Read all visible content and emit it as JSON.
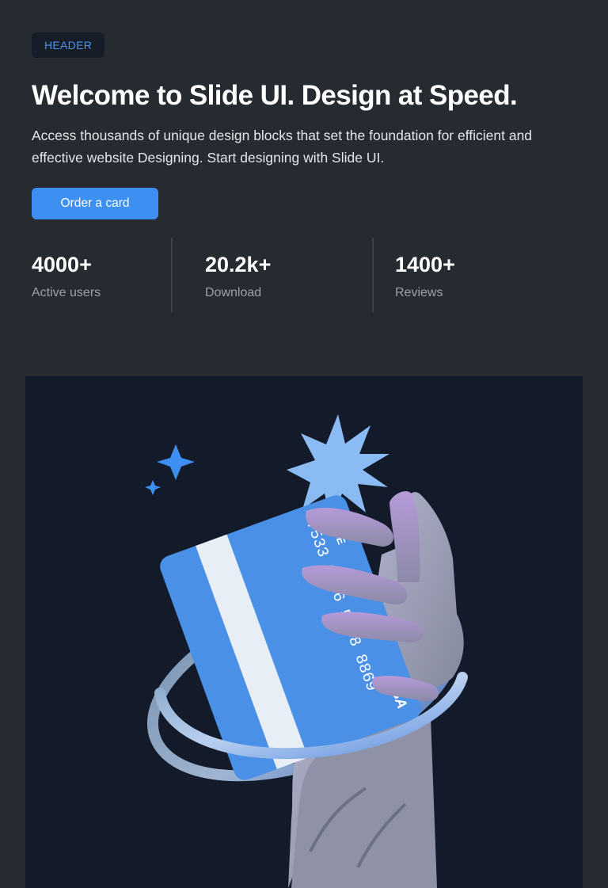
{
  "header": {
    "badge": "HEADER",
    "title": "Welcome to Slide UI. Design at Speed.",
    "description": "Access thousands of unique design blocks that set the foundation for efficient and effective website Designing. Start designing with Slide UI.",
    "cta_label": "Order a card"
  },
  "stats": [
    {
      "value": "4000+",
      "label": "Active users"
    },
    {
      "value": "20.2k+",
      "label": "Download"
    },
    {
      "value": "1400+",
      "label": "Reviews"
    }
  ],
  "illustration": {
    "card_brand": "SLIDE",
    "card_number": "7533 0236 5568 8869",
    "card_network": "VISA"
  },
  "colors": {
    "background": "#262b31",
    "panel": "#131a29",
    "accent": "#3d8ff2",
    "badge_text": "#4c93ea",
    "card": "#4a90e6"
  }
}
